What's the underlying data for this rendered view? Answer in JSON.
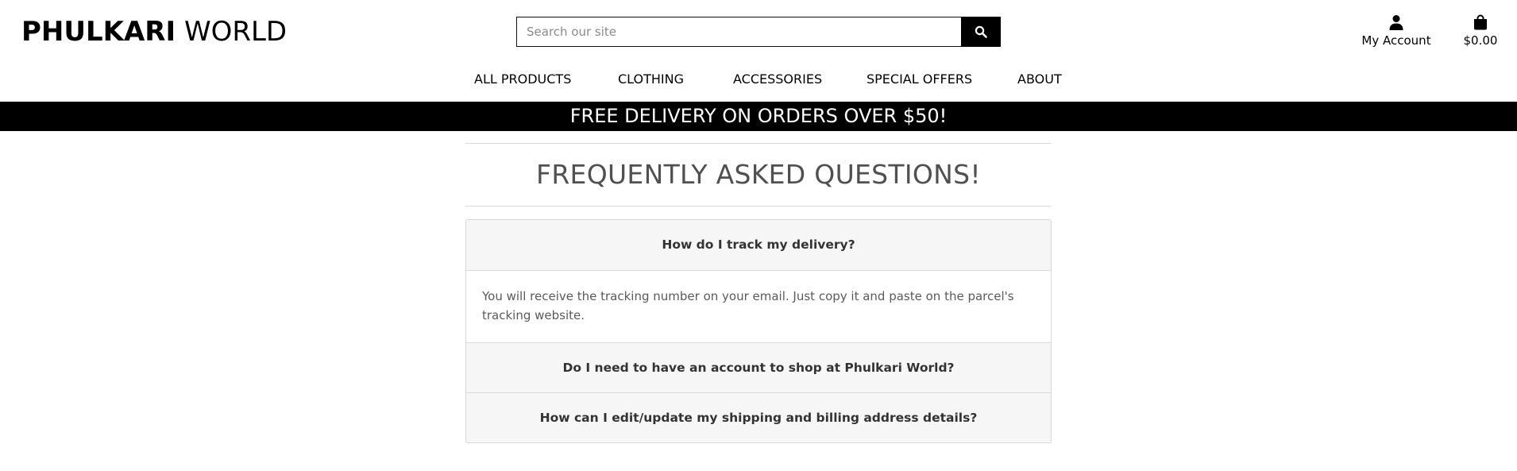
{
  "header": {
    "logo_bold": "PHULKARI",
    "logo_light": "WORLD",
    "search_placeholder": "Search our site",
    "account_label": "My Account",
    "bag_total": "$0.00"
  },
  "nav": {
    "items": [
      "ALL PRODUCTS",
      "CLOTHING",
      "ACCESSORIES",
      "SPECIAL OFFERS",
      "ABOUT"
    ]
  },
  "banner": {
    "text": "FREE DELIVERY ON ORDERS OVER $50!"
  },
  "faq": {
    "title": "FREQUENTLY ASKED QUESTIONS!",
    "items": [
      {
        "question": "How do I track my delivery?",
        "answer": "You will receive the tracking number on your email. Just copy it and paste on the parcel's tracking website.",
        "expanded": true
      },
      {
        "question": "Do I need to have an account to shop at Phulkari World?",
        "expanded": false
      },
      {
        "question": "How can I edit/update my shipping and billing address details?",
        "expanded": false
      }
    ]
  },
  "icons": {
    "search": "search-icon",
    "account": "user-icon",
    "bag": "shopping-bag-icon"
  },
  "colors": {
    "brand_black": "#000000",
    "accordion_header_bg": "#f6f6f6",
    "title_gray": "#505050"
  }
}
